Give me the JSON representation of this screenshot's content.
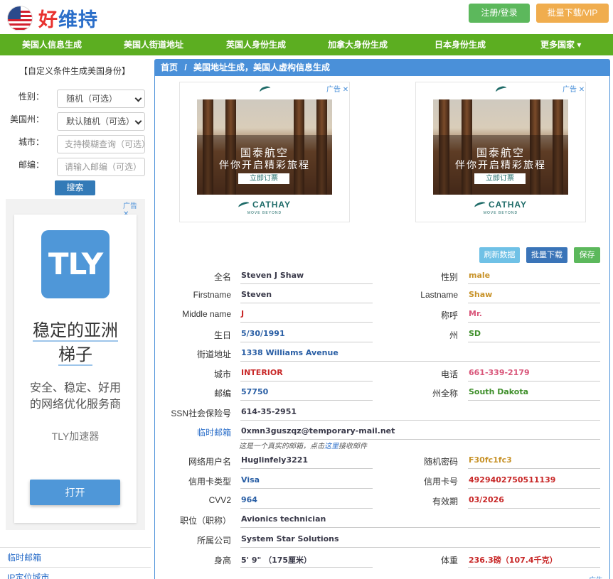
{
  "header": {
    "logo_text_a": "好",
    "logo_text_b": "维持",
    "login_label": "注册/登录",
    "vip_label": "批量下载/VIP"
  },
  "nav": {
    "items": [
      "美国人信息生成",
      "美国人街道地址",
      "英国人身份生成",
      "加拿大身份生成",
      "日本身份生成",
      "更多国家 ▾"
    ]
  },
  "sidebar": {
    "title": "【自定义条件生成美国身份】",
    "gender_label": "性别：",
    "gender_value": "随机（可选）",
    "state_label": "美国州：",
    "state_value": "默认随机（可选）",
    "city_label": "城市：",
    "city_placeholder": "支持模糊查询（可选）",
    "zip_label": "邮编：",
    "zip_placeholder": "请输入邮编（可选）",
    "search_label": "搜索",
    "ad_tag": "广告",
    "ad": {
      "logo": "TLY",
      "headline_1": "稳定的亚洲",
      "headline_2": "梯子",
      "sub_1": "安全、稳定、好用",
      "sub_2": "的网络优化服务商",
      "name": "TLY加速器",
      "button": "打开"
    },
    "links": [
      "临时邮箱",
      "IP定位城市"
    ]
  },
  "panel": {
    "breadcrumb_home": "首页",
    "breadcrumb_sep": "/",
    "breadcrumb_current": "美国地址生成，美国人虚构信息生成",
    "ad_tag": "广告",
    "ad_line1": "国泰航空",
    "ad_line2": "伴你开启精彩旅程",
    "ad_cta": "立即订票",
    "ad_brand": "CATHAY",
    "ad_slogan": "MOVE BEYOND",
    "refresh_label": "刷新数据",
    "download_label": "批量下载",
    "save_label": "保存"
  },
  "profile": {
    "fullname_label": "全名",
    "fullname": "Steven J Shaw",
    "gender_label": "性别",
    "gender": "male",
    "firstname_label": "Firstname",
    "firstname": "Steven",
    "lastname_label": "Lastname",
    "lastname": "Shaw",
    "middlename_label": "Middle name",
    "middlename": "J",
    "title_label": "称呼",
    "title": "Mr.",
    "birthday_label": "生日",
    "birthday": "5/30/1991",
    "state_label": "州",
    "state": "SD",
    "street_label": "街道地址",
    "street": "1338 Williams Avenue",
    "city_label": "城市",
    "city": "INTERIOR",
    "phone_label": "电话",
    "phone": "661-339-2179",
    "zip_label": "邮编",
    "zip": "57750",
    "state_full_label": "州全称",
    "state_full": "South Dakota",
    "ssn_label": "SSN社会保险号",
    "ssn": "614-35-2951",
    "email_label": "临时邮箱",
    "email": "0xmn3guszqz@temporary-mail.net",
    "email_note_a": "这是一个真实的邮箱，点击",
    "email_note_link": "这里",
    "email_note_b": "接收邮件",
    "username_label": "网络用户名",
    "username": "Huglinfely3221",
    "password_label": "随机密码",
    "password": "F30fc1fc3",
    "card_type_label": "信用卡类型",
    "card_type": "Visa",
    "card_no_label": "信用卡号",
    "card_no": "4929402750511139",
    "cvv_label": "CVV2",
    "cvv": "964",
    "expiry_label": "有效期",
    "expiry": "03/2026",
    "job_label": "职位（职称）",
    "job": "Avionics technician",
    "company_label": "所属公司",
    "company": "System Star Solutions",
    "height_label": "身高",
    "height": "5' 9\"  （175厘米）",
    "weight_label": "体重",
    "weight": "236.3磅（107.4千克）"
  },
  "colors": {
    "nav_green": "#5cae21",
    "panel_blue": "#4a90d9",
    "login_green": "#5cb85c",
    "vip_orange": "#f0ad4e"
  }
}
